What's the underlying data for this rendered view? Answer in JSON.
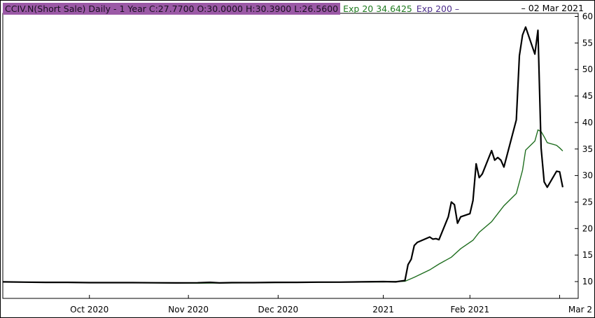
{
  "header": {
    "symbol_info": "CCIV.N(Short Sale) Daily -  1 Year   C:27.7700 O:30.0000 H:30.3900 L:26.5600",
    "ema20_label": "Exp 20 34.6425",
    "ema200_label": "Exp 200 –",
    "date_label": "–  02 Mar 2021"
  },
  "colors": {
    "price_line": "#000000",
    "ema20_line": "#1f6e1f",
    "symbol_box": "#9b59a6",
    "axis": "#000000"
  },
  "chart_data": {
    "type": "line",
    "title": "CCIV.N(Short Sale) Daily - 1 Year",
    "ylim": [
      7,
      61
    ],
    "y_ticks": [
      10,
      15,
      20,
      25,
      30,
      35,
      40,
      45,
      50,
      55,
      60
    ],
    "x_ticks": [
      {
        "label": "Oct 2020",
        "date": "2020-10-01"
      },
      {
        "label": "Nov 2020",
        "date": "2020-11-02"
      },
      {
        "label": "Dec 2020",
        "date": "2020-12-01"
      },
      {
        "label": "2021",
        "date": "2021-01-04"
      },
      {
        "label": "Feb 2021",
        "date": "2021-02-01"
      },
      {
        "label": "Mar 2",
        "date": "2021-03-02"
      }
    ],
    "x_range": [
      "2020-09-03",
      "2021-03-08"
    ],
    "series": [
      {
        "name": "CCIV.N",
        "points": [
          [
            "2020-09-03",
            9.95
          ],
          [
            "2020-09-10",
            9.9
          ],
          [
            "2020-09-17",
            9.85
          ],
          [
            "2020-09-24",
            9.85
          ],
          [
            "2020-10-01",
            9.8
          ],
          [
            "2020-10-08",
            9.8
          ],
          [
            "2020-10-15",
            9.8
          ],
          [
            "2020-10-22",
            9.78
          ],
          [
            "2020-10-29",
            9.75
          ],
          [
            "2020-11-05",
            9.78
          ],
          [
            "2020-11-09",
            9.85
          ],
          [
            "2020-11-12",
            9.75
          ],
          [
            "2020-11-16",
            9.8
          ],
          [
            "2020-11-23",
            9.8
          ],
          [
            "2020-11-30",
            9.85
          ],
          [
            "2020-12-07",
            9.85
          ],
          [
            "2020-12-14",
            9.9
          ],
          [
            "2020-12-21",
            9.9
          ],
          [
            "2020-12-28",
            9.95
          ],
          [
            "2021-01-04",
            10.0
          ],
          [
            "2021-01-08",
            9.95
          ],
          [
            "2021-01-11",
            10.2
          ],
          [
            "2021-01-12",
            13.2
          ],
          [
            "2021-01-13",
            14.2
          ],
          [
            "2021-01-14",
            16.8
          ],
          [
            "2021-01-15",
            17.4
          ],
          [
            "2021-01-19",
            18.4
          ],
          [
            "2021-01-20",
            18.0
          ],
          [
            "2021-01-21",
            18.1
          ],
          [
            "2021-01-22",
            17.9
          ],
          [
            "2021-01-25",
            22.2
          ],
          [
            "2021-01-26",
            25.0
          ],
          [
            "2021-01-27",
            24.5
          ],
          [
            "2021-01-28",
            21.0
          ],
          [
            "2021-01-29",
            22.2
          ],
          [
            "2021-02-01",
            22.8
          ],
          [
            "2021-02-02",
            25.3
          ],
          [
            "2021-02-03",
            32.2
          ],
          [
            "2021-02-04",
            29.6
          ],
          [
            "2021-02-05",
            30.3
          ],
          [
            "2021-02-08",
            34.7
          ],
          [
            "2021-02-09",
            32.9
          ],
          [
            "2021-02-10",
            33.4
          ],
          [
            "2021-02-11",
            32.9
          ],
          [
            "2021-02-12",
            31.6
          ],
          [
            "2021-02-16",
            40.5
          ],
          [
            "2021-02-17",
            52.6
          ],
          [
            "2021-02-18",
            56.5
          ],
          [
            "2021-02-19",
            58.0
          ],
          [
            "2021-02-22",
            52.9
          ],
          [
            "2021-02-23",
            57.4
          ],
          [
            "2021-02-24",
            35.2
          ],
          [
            "2021-02-25",
            28.8
          ],
          [
            "2021-02-26",
            27.8
          ],
          [
            "2021-03-01",
            30.8
          ],
          [
            "2021-03-02",
            30.7
          ],
          [
            "2021-03-03",
            27.8
          ]
        ]
      },
      {
        "name": "Exp 20",
        "points": [
          [
            "2020-09-03",
            9.95
          ],
          [
            "2020-09-24",
            9.85
          ],
          [
            "2020-10-22",
            9.75
          ],
          [
            "2020-11-05",
            9.7
          ],
          [
            "2020-11-16",
            9.75
          ],
          [
            "2020-12-01",
            9.82
          ],
          [
            "2020-12-21",
            9.9
          ],
          [
            "2021-01-04",
            9.95
          ],
          [
            "2021-01-11",
            10.05
          ],
          [
            "2021-01-14",
            10.8
          ],
          [
            "2021-01-19",
            12.2
          ],
          [
            "2021-01-22",
            13.3
          ],
          [
            "2021-01-26",
            14.6
          ],
          [
            "2021-01-29",
            16.2
          ],
          [
            "2021-02-02",
            17.8
          ],
          [
            "2021-02-04",
            19.3
          ],
          [
            "2021-02-08",
            21.3
          ],
          [
            "2021-02-10",
            22.8
          ],
          [
            "2021-02-12",
            24.3
          ],
          [
            "2021-02-16",
            26.6
          ],
          [
            "2021-02-18",
            31.0
          ],
          [
            "2021-02-19",
            34.8
          ],
          [
            "2021-02-22",
            36.5
          ],
          [
            "2021-02-23",
            38.6
          ],
          [
            "2021-02-24",
            38.3
          ],
          [
            "2021-02-25",
            37.3
          ],
          [
            "2021-02-26",
            36.2
          ],
          [
            "2021-03-01",
            35.7
          ],
          [
            "2021-03-02",
            35.2
          ],
          [
            "2021-03-03",
            34.64
          ]
        ]
      }
    ]
  }
}
